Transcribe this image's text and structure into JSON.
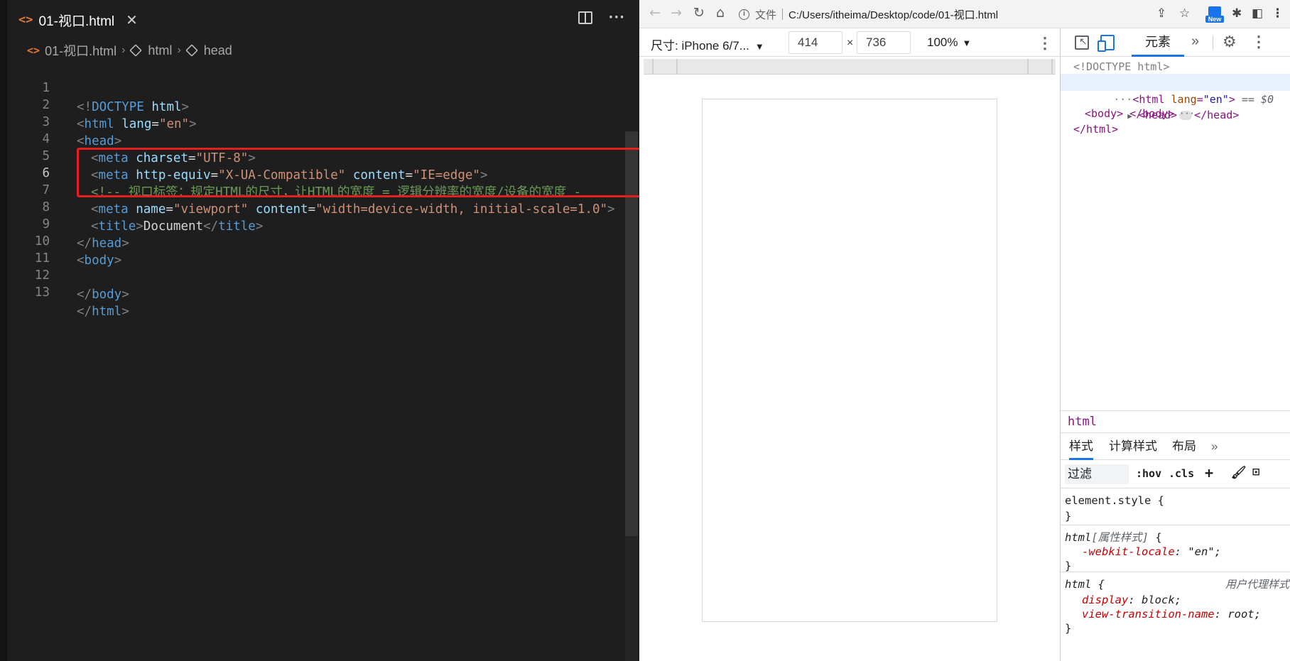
{
  "editor": {
    "tab": {
      "icon": "html-file-icon",
      "title": "01-视口.html"
    },
    "breadcrumb": [
      "01-视口.html",
      "html",
      "head"
    ],
    "lines": [
      {
        "n": "1"
      },
      {
        "n": "2"
      },
      {
        "n": "3"
      },
      {
        "n": "4"
      },
      {
        "n": "5"
      },
      {
        "n": "6"
      },
      {
        "n": "7"
      },
      {
        "n": "8"
      },
      {
        "n": "9"
      },
      {
        "n": "10"
      },
      {
        "n": "11"
      },
      {
        "n": "12"
      },
      {
        "n": "13"
      }
    ],
    "code": {
      "l1_open": "<!",
      "l1_kw": "DOCTYPE",
      "l1_sp": " ",
      "l1_html": "html",
      "l1_close": ">",
      "l2_open": "<",
      "l2_tag": "html",
      "l2_attr": " lang",
      "l2_eq": "=",
      "l2_val": "\"en\"",
      "l2_close": ">",
      "l3_open": "<",
      "l3_tag": "head",
      "l3_close": ">",
      "l4_open": "<",
      "l4_tag": "meta",
      "l4_attr": " charset",
      "l4_eq": "=",
      "l4_val": "\"UTF-8\"",
      "l4_close": ">",
      "l5_open": "<",
      "l5_tag": "meta",
      "l5_attr1": " http-equiv",
      "l5_eq1": "=",
      "l5_val1": "\"X-UA-Compatible\"",
      "l5_attr2": " content",
      "l5_eq2": "=",
      "l5_val2": "\"IE=edge\"",
      "l5_close": ">",
      "l6_comment": "<!-- 视口标签：规定HTML的尺寸，让HTML的宽度 = 逻辑分辨率的宽度/设备的宽度 -",
      "l7_open": "<",
      "l7_tag": "meta",
      "l7_attr1": " name",
      "l7_eq1": "=",
      "l7_val1": "\"viewport\"",
      "l7_attr2": " content",
      "l7_eq2": "=",
      "l7_val2": "\"width=device-width, initial-scale=1.0\"",
      "l7_close": ">",
      "l8_open": "<",
      "l8_tag": "title",
      "l8_close": ">",
      "l8_text": "Document",
      "l8_eopen": "</",
      "l8_etag": "title",
      "l8_eclose": ">",
      "l9_open": "</",
      "l9_tag": "head",
      "l9_close": ">",
      "l10_open": "<",
      "l10_tag": "body",
      "l10_close": ">",
      "l12_open": "</",
      "l12_tag": "body",
      "l12_close": ">",
      "l13_open": "</",
      "l13_tag": "html",
      "l13_close": ">"
    }
  },
  "browser": {
    "url_scheme_label": "文件",
    "url": "C:/Users/itheima/Desktop/code/01-视口.html",
    "new_badge": "New",
    "device_toolbar": {
      "device": "尺寸: iPhone 6/7...",
      "width": "414",
      "height": "736",
      "times": "×",
      "zoom": "100%"
    },
    "devtools": {
      "tab_elements": "元素",
      "dom": {
        "doctype": "<!DOCTYPE html>",
        "html_open_tag": "<html",
        "html_attr": " lang",
        "html_eq": "=",
        "html_val": "\"en\"",
        "html_close": ">",
        "eq_sel": " == $0",
        "head_open": "<head>",
        "head_close": "</head>",
        "body_line": "<body> </body>",
        "html_end": "</html>",
        "ellipsis": "···",
        "dots": "···"
      },
      "breadcrumb": "html",
      "style_tabs": [
        "样式",
        "计算样式",
        "布局"
      ],
      "filter_placeholder": "过滤",
      "hov": ":hov",
      "cls": ".cls",
      "rules": {
        "r1_sel": "element.style {",
        "r1_end": "}",
        "r2_sel_a": "html",
        "r2_sel_b": "[属性样式]",
        "r2_sel_c": " {",
        "r2_prop": "-webkit-locale",
        "r2_colon": ": ",
        "r2_val": "\"en\";",
        "r2_end": "}",
        "r3_sel": "html {",
        "r3_origin": "用户代理样式",
        "r3_p1": "display",
        "r3_v1": ": block;",
        "r3_p2": "view-transition-name",
        "r3_v2": ": root;",
        "r3_end": "}"
      }
    }
  },
  "colors": {
    "highlight_box": "#e51f1f",
    "accent": "#1a73e8"
  }
}
